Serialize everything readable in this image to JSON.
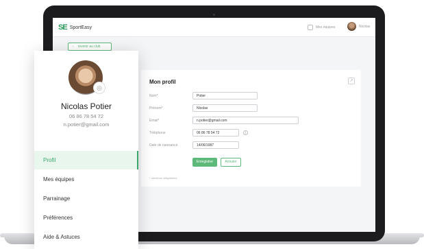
{
  "header": {
    "logo_mark": "SE",
    "logo_text": "SportEasy",
    "teams_label": "Mes équipes",
    "user_label": "Nicolas"
  },
  "back_link": {
    "label": "revenir au club"
  },
  "form": {
    "title": "Mon profil",
    "fields": [
      {
        "label": "Nom*",
        "value": "Potier"
      },
      {
        "label": "Prénom*",
        "value": "Nicolas"
      },
      {
        "label": "Email*",
        "value": "n.potier@gmail.com"
      },
      {
        "label": "Téléphone",
        "value": "06 86 78 54 72"
      },
      {
        "label": "Date de naissance",
        "value": "14/06/1987"
      }
    ],
    "save_label": "Enregistrer",
    "cancel_label": "Annuler",
    "required_note": "* mentions obligatoires"
  },
  "profile": {
    "name": "Nicolas Potier",
    "phone": "06 86 78 54 72",
    "email": "n.potier@gmail.com"
  },
  "nav": {
    "items": [
      {
        "label": "Profil",
        "active": true
      },
      {
        "label": "Mes équipes",
        "active": false
      },
      {
        "label": "Parrainage",
        "active": false
      },
      {
        "label": "Préférences",
        "active": false
      },
      {
        "label": "Aide & Astuces",
        "active": false
      }
    ]
  },
  "colors": {
    "accent": "#3aa66a",
    "brand": "#2b9a5a"
  }
}
